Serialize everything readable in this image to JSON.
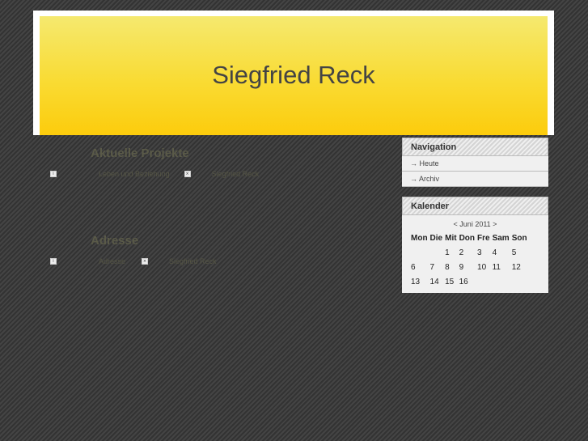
{
  "site": {
    "title": "Siegfried Reck"
  },
  "posts": [
    {
      "title": "Aktuelle Projekte",
      "meta_category": "Leben und Beziehung",
      "meta_author": "Siegfried Reck"
    },
    {
      "title": "Adresse",
      "meta_category": "Adresse",
      "meta_author": "Siegfried Reck"
    }
  ],
  "navigation": {
    "title": "Navigation",
    "items": [
      {
        "label": "→ Heute"
      },
      {
        "label": "→ Archiv"
      }
    ]
  },
  "calendar": {
    "title": "Kalender",
    "caption": "< Juni 2011 >",
    "weekdays": [
      "Mon",
      "Die",
      "Mit",
      "Don",
      "Fre",
      "Sam",
      "Son"
    ],
    "weeks": [
      [
        "",
        "",
        "1",
        "2",
        "3",
        "4",
        "5"
      ],
      [
        "6",
        "7",
        "8",
        "9",
        "10",
        "11",
        "12"
      ],
      [
        "13",
        "14",
        "15",
        "16",
        "",
        "",
        ""
      ]
    ]
  },
  "icons": {
    "info": "info-icon",
    "close": "close-icon"
  }
}
